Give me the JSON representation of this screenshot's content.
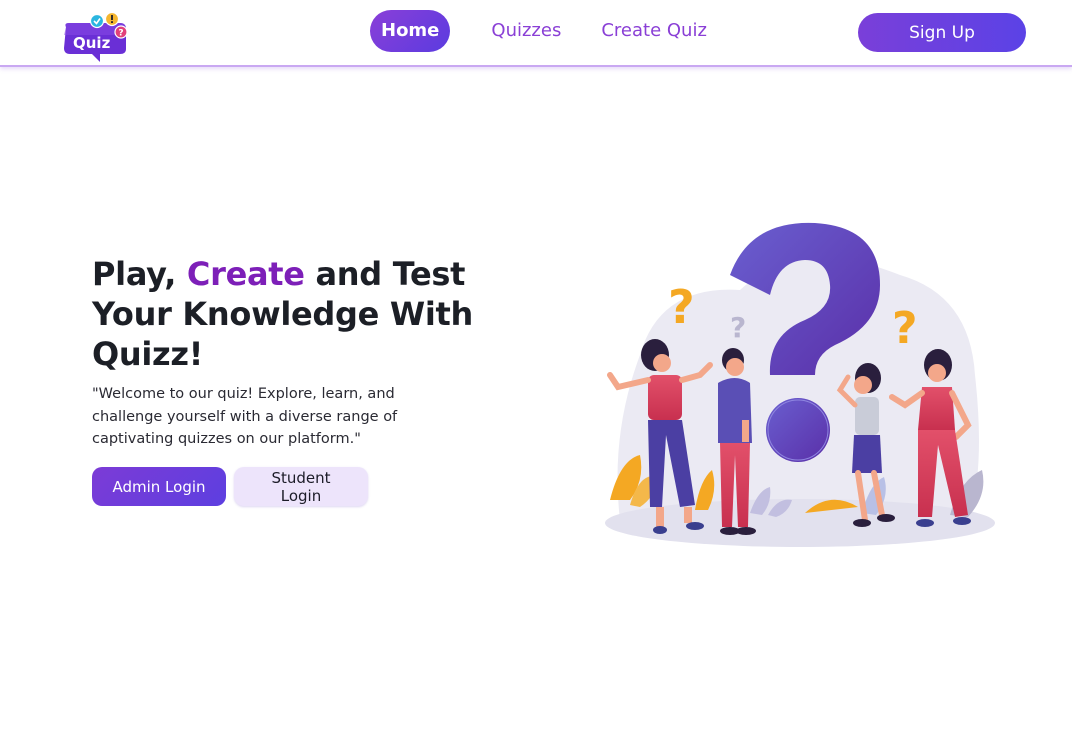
{
  "brand": {
    "logo_text": "Quiz",
    "logo_colors": {
      "bubble": "#6a2fd6",
      "check": "#2bb6e0",
      "exclaim": "#f5b630",
      "question": "#e2407a"
    }
  },
  "nav": {
    "items": [
      {
        "label": "Home",
        "active": true
      },
      {
        "label": "Quizzes",
        "active": false
      },
      {
        "label": "Create Quiz",
        "active": false
      }
    ],
    "signup_label": "Sign Up"
  },
  "hero": {
    "title_part1": "Play, ",
    "title_accent": "Create",
    "title_part2": " and Test Your Knowledge With Quizz!",
    "description": "\"Welcome to our quiz! Explore, learn, and challenge yourself with a diverse range of captivating quizzes on our platform.\"",
    "admin_login_label": "Admin Login",
    "student_login_label": "Student Login"
  },
  "colors": {
    "accent_purple": "#7d1fb8",
    "button_gradient_start": "#7c3bd6",
    "button_gradient_end": "#5d3fe0",
    "secondary_button_bg": "#ede4fb",
    "nav_link": "#8a3fd6"
  }
}
